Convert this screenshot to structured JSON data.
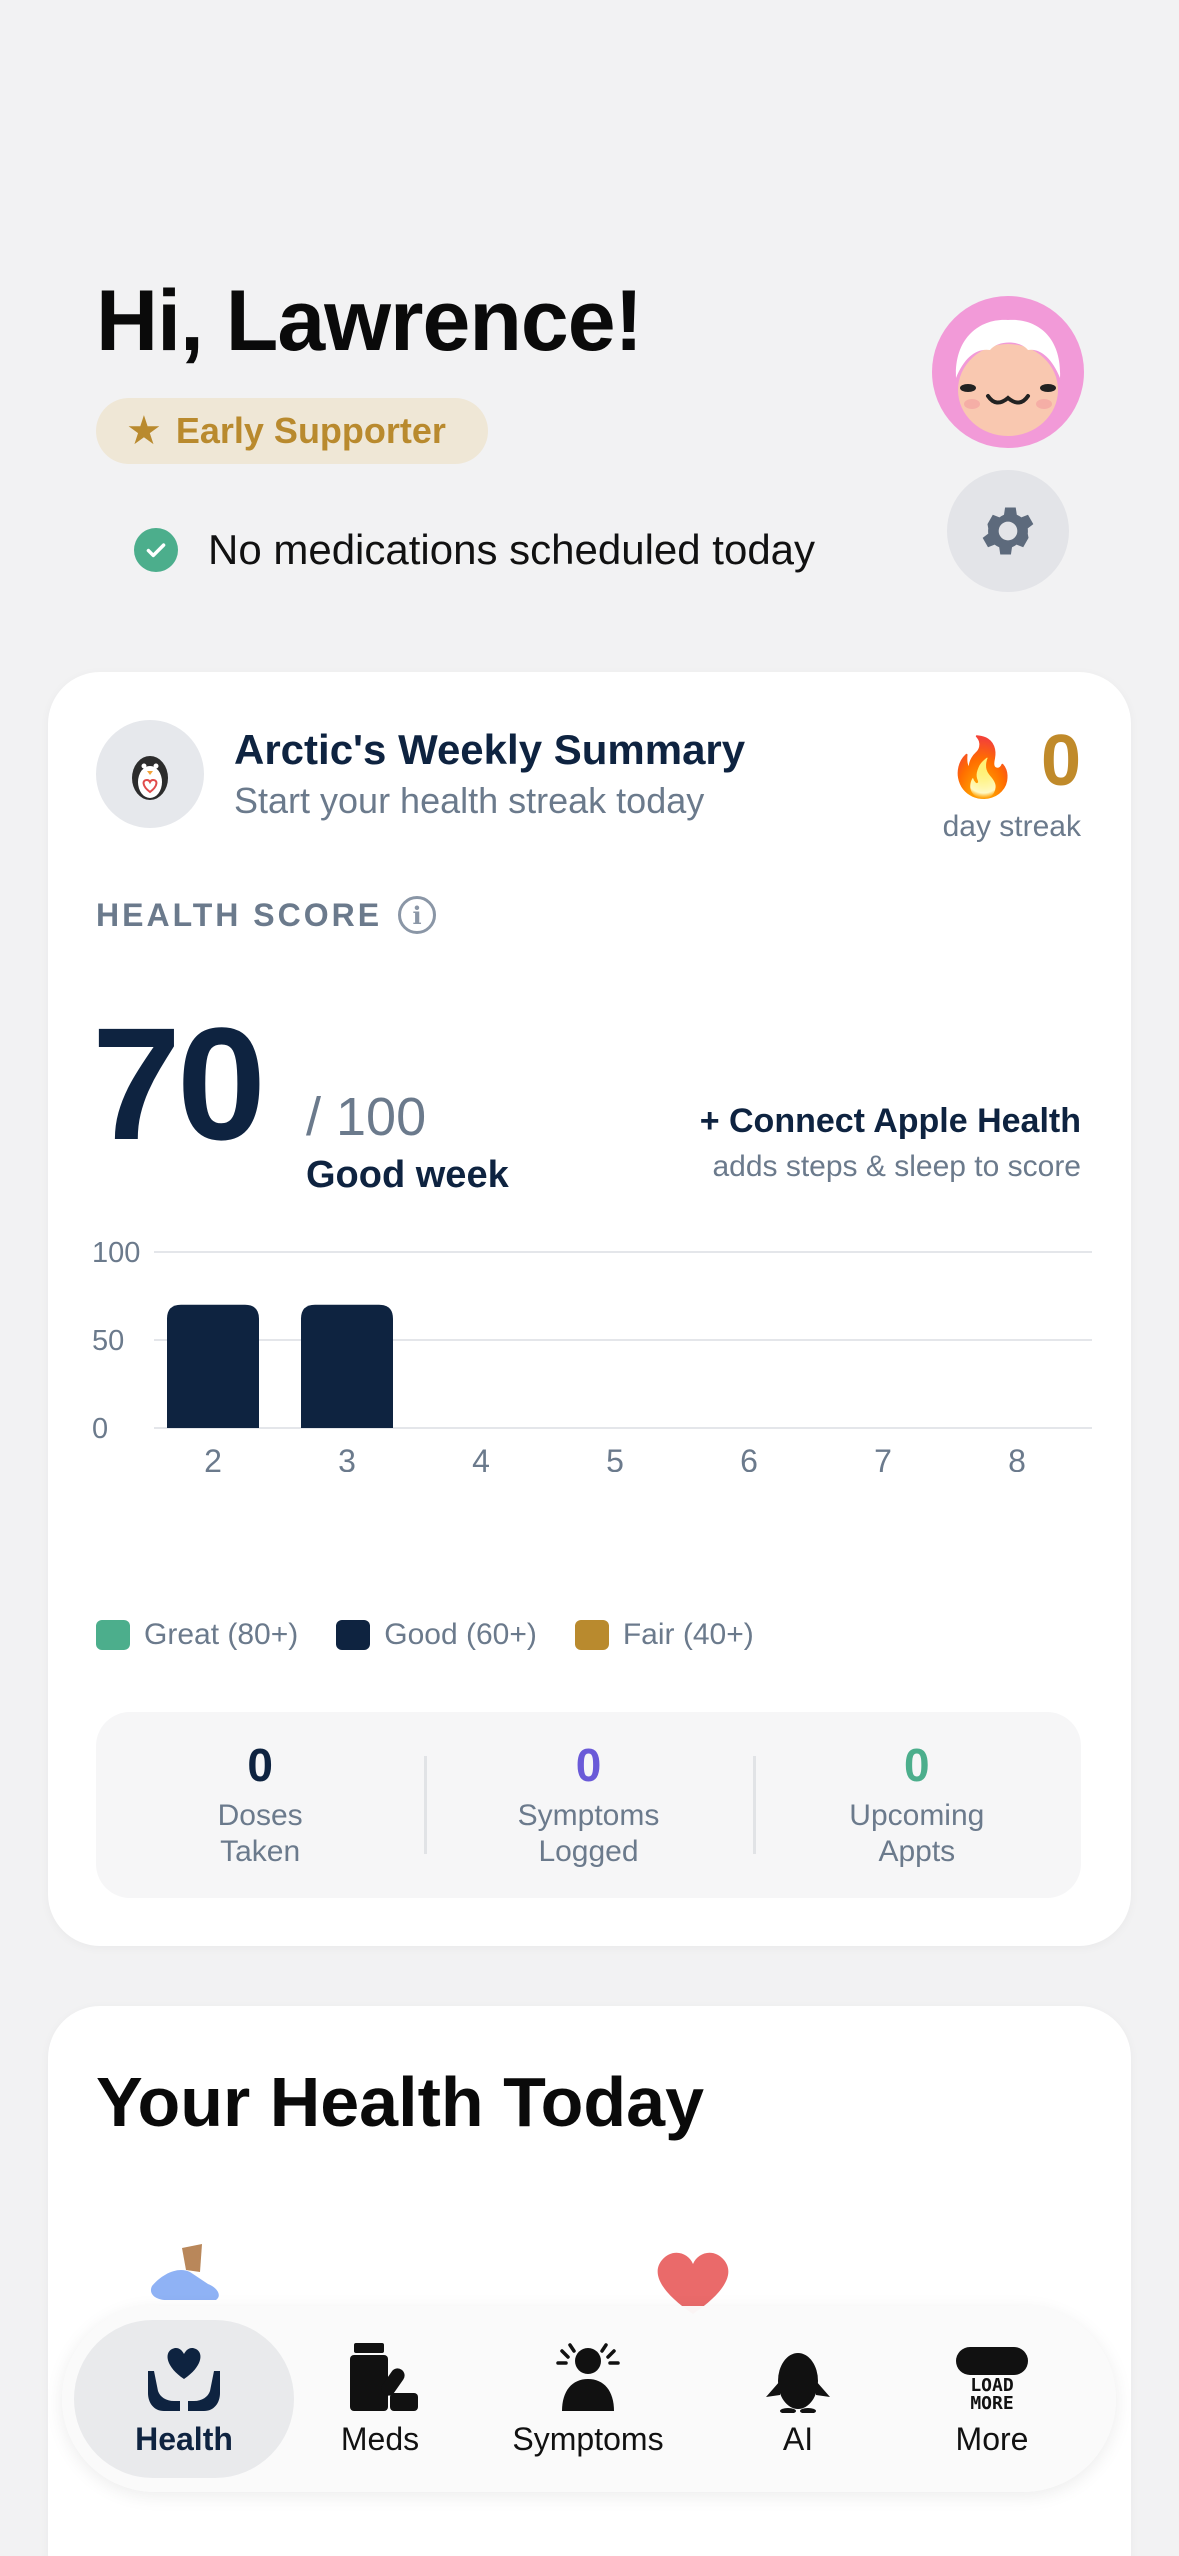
{
  "header": {
    "greeting": "Hi, Lawrence!",
    "badge": "Early Supporter",
    "status": "No medications scheduled today"
  },
  "summary": {
    "title": "Arctic's Weekly Summary",
    "subtitle": "Start your health streak today",
    "streak_value": "0",
    "streak_label": "day streak"
  },
  "health_score": {
    "label": "HEALTH SCORE",
    "score": "70",
    "out_of": "/ 100",
    "quality": "Good week",
    "connect": "+ Connect Apple Health",
    "connect_sub": "adds steps & sleep to score"
  },
  "chart_data": {
    "type": "bar",
    "categories": [
      "2",
      "3",
      "4",
      "5",
      "6",
      "7",
      "8"
    ],
    "values": [
      70,
      70,
      null,
      null,
      null,
      null,
      null
    ],
    "ylim": [
      0,
      100
    ],
    "yticks": [
      0,
      50,
      100
    ],
    "legend": [
      {
        "label": "Great (80+)",
        "color": "#4cae8c"
      },
      {
        "label": "Good (60+)",
        "color": "#0e2340"
      },
      {
        "label": "Fair (40+)",
        "color": "#b98a2e"
      }
    ]
  },
  "stats": [
    {
      "value": "0",
      "line1": "Doses",
      "line2": "Taken",
      "color": "#0e2340"
    },
    {
      "value": "0",
      "line1": "Symptoms",
      "line2": "Logged",
      "color": "#6a5ad8"
    },
    {
      "value": "0",
      "line1": "Upcoming",
      "line2": "Appts",
      "color": "#4cae8c"
    }
  ],
  "today": {
    "title": "Your Health Today"
  },
  "tabs": [
    {
      "label": "Health",
      "icon": "hands-heart-icon",
      "active": true
    },
    {
      "label": "Meds",
      "icon": "pill-bottle-icon",
      "active": false
    },
    {
      "label": "Symptoms",
      "icon": "person-symptoms-icon",
      "active": false
    },
    {
      "label": "AI",
      "icon": "penguin-icon",
      "active": false
    },
    {
      "label": "More",
      "icon": "load-more-icon",
      "active": false
    }
  ],
  "tab_icon_text": {
    "line1": "LOAD",
    "line2": "MORE"
  }
}
